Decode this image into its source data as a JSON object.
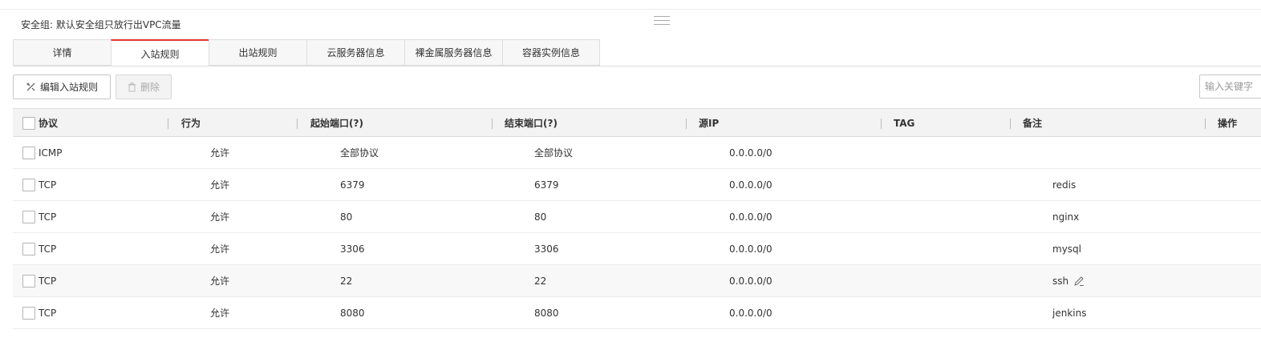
{
  "security_group": {
    "label": "安全组: 默认安全组只放行出VPC流量"
  },
  "tabs": [
    {
      "label": "详情",
      "active": false
    },
    {
      "label": "入站规则",
      "active": true
    },
    {
      "label": "出站规则",
      "active": false
    },
    {
      "label": "云服务器信息",
      "active": false
    },
    {
      "label": "裸金属服务器信息",
      "active": false
    },
    {
      "label": "容器实例信息",
      "active": false
    }
  ],
  "toolbar": {
    "edit_label": "编辑入站规则",
    "delete_label": "删除",
    "search_placeholder": "输入关键字"
  },
  "table": {
    "headers": {
      "protocol": "协议",
      "action": "行为",
      "start_port": "起始端口(?)",
      "end_port": "结束端口(?)",
      "source_ip": "源IP",
      "tag": "TAG",
      "remark": "备注",
      "operation": "操作"
    },
    "rows": [
      {
        "protocol": "ICMP",
        "action": "允许",
        "start_port": "全部协议",
        "end_port": "全部协议",
        "source_ip": "0.0.0.0/0",
        "remark": ""
      },
      {
        "protocol": "TCP",
        "action": "允许",
        "start_port": "6379",
        "end_port": "6379",
        "source_ip": "0.0.0.0/0",
        "remark": "redis"
      },
      {
        "protocol": "TCP",
        "action": "允许",
        "start_port": "80",
        "end_port": "80",
        "source_ip": "0.0.0.0/0",
        "remark": "nginx"
      },
      {
        "protocol": "TCP",
        "action": "允许",
        "start_port": "3306",
        "end_port": "3306",
        "source_ip": "0.0.0.0/0",
        "remark": "mysql"
      },
      {
        "protocol": "TCP",
        "action": "允许",
        "start_port": "22",
        "end_port": "22",
        "source_ip": "0.0.0.0/0",
        "remark": "ssh"
      },
      {
        "protocol": "TCP",
        "action": "允许",
        "start_port": "8080",
        "end_port": "8080",
        "source_ip": "0.0.0.0/0",
        "remark": "jenkins"
      }
    ]
  },
  "icons": {
    "edit": "edit-rules-icon",
    "delete": "trash-icon",
    "remark_edit": "pencil-icon",
    "drag": "drag-handle-icon"
  },
  "colors": {
    "active_tab_accent": "#e5342d",
    "header_bg": "#f3f3f3"
  }
}
